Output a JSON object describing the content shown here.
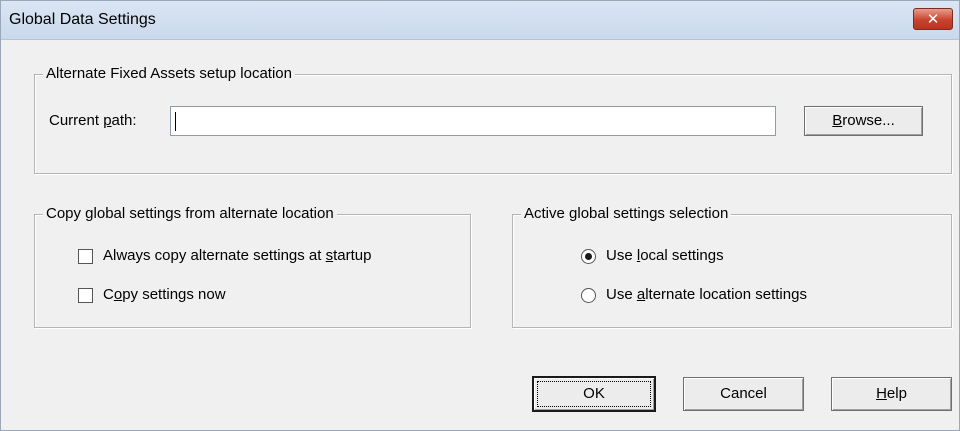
{
  "window": {
    "title": "Global Data Settings",
    "close_glyph": "✕"
  },
  "setup_location": {
    "legend": "Alternate Fixed Assets setup location",
    "path_label_pre": "Current ",
    "path_label_u": "p",
    "path_label_post": "ath:",
    "path_value": "",
    "browse_u": "B",
    "browse_rest": "rowse..."
  },
  "copy_settings": {
    "legend": "Copy global settings from alternate location",
    "always_copy": {
      "pre": "Always copy alternate settings at ",
      "u": "s",
      "post": "tartup",
      "checked": false
    },
    "copy_now": {
      "pre": "C",
      "u": "o",
      "post": "py settings now",
      "checked": false
    }
  },
  "active_selection": {
    "legend": "Active global settings selection",
    "local": {
      "pre": "Use ",
      "u": "l",
      "post": "ocal settings",
      "selected": true
    },
    "alternate": {
      "pre": "Use ",
      "u": "a",
      "post": "lternate location settings",
      "selected": false
    }
  },
  "buttons": {
    "ok": "OK",
    "cancel": "Cancel",
    "help_u": "H",
    "help_rest": "elp"
  }
}
